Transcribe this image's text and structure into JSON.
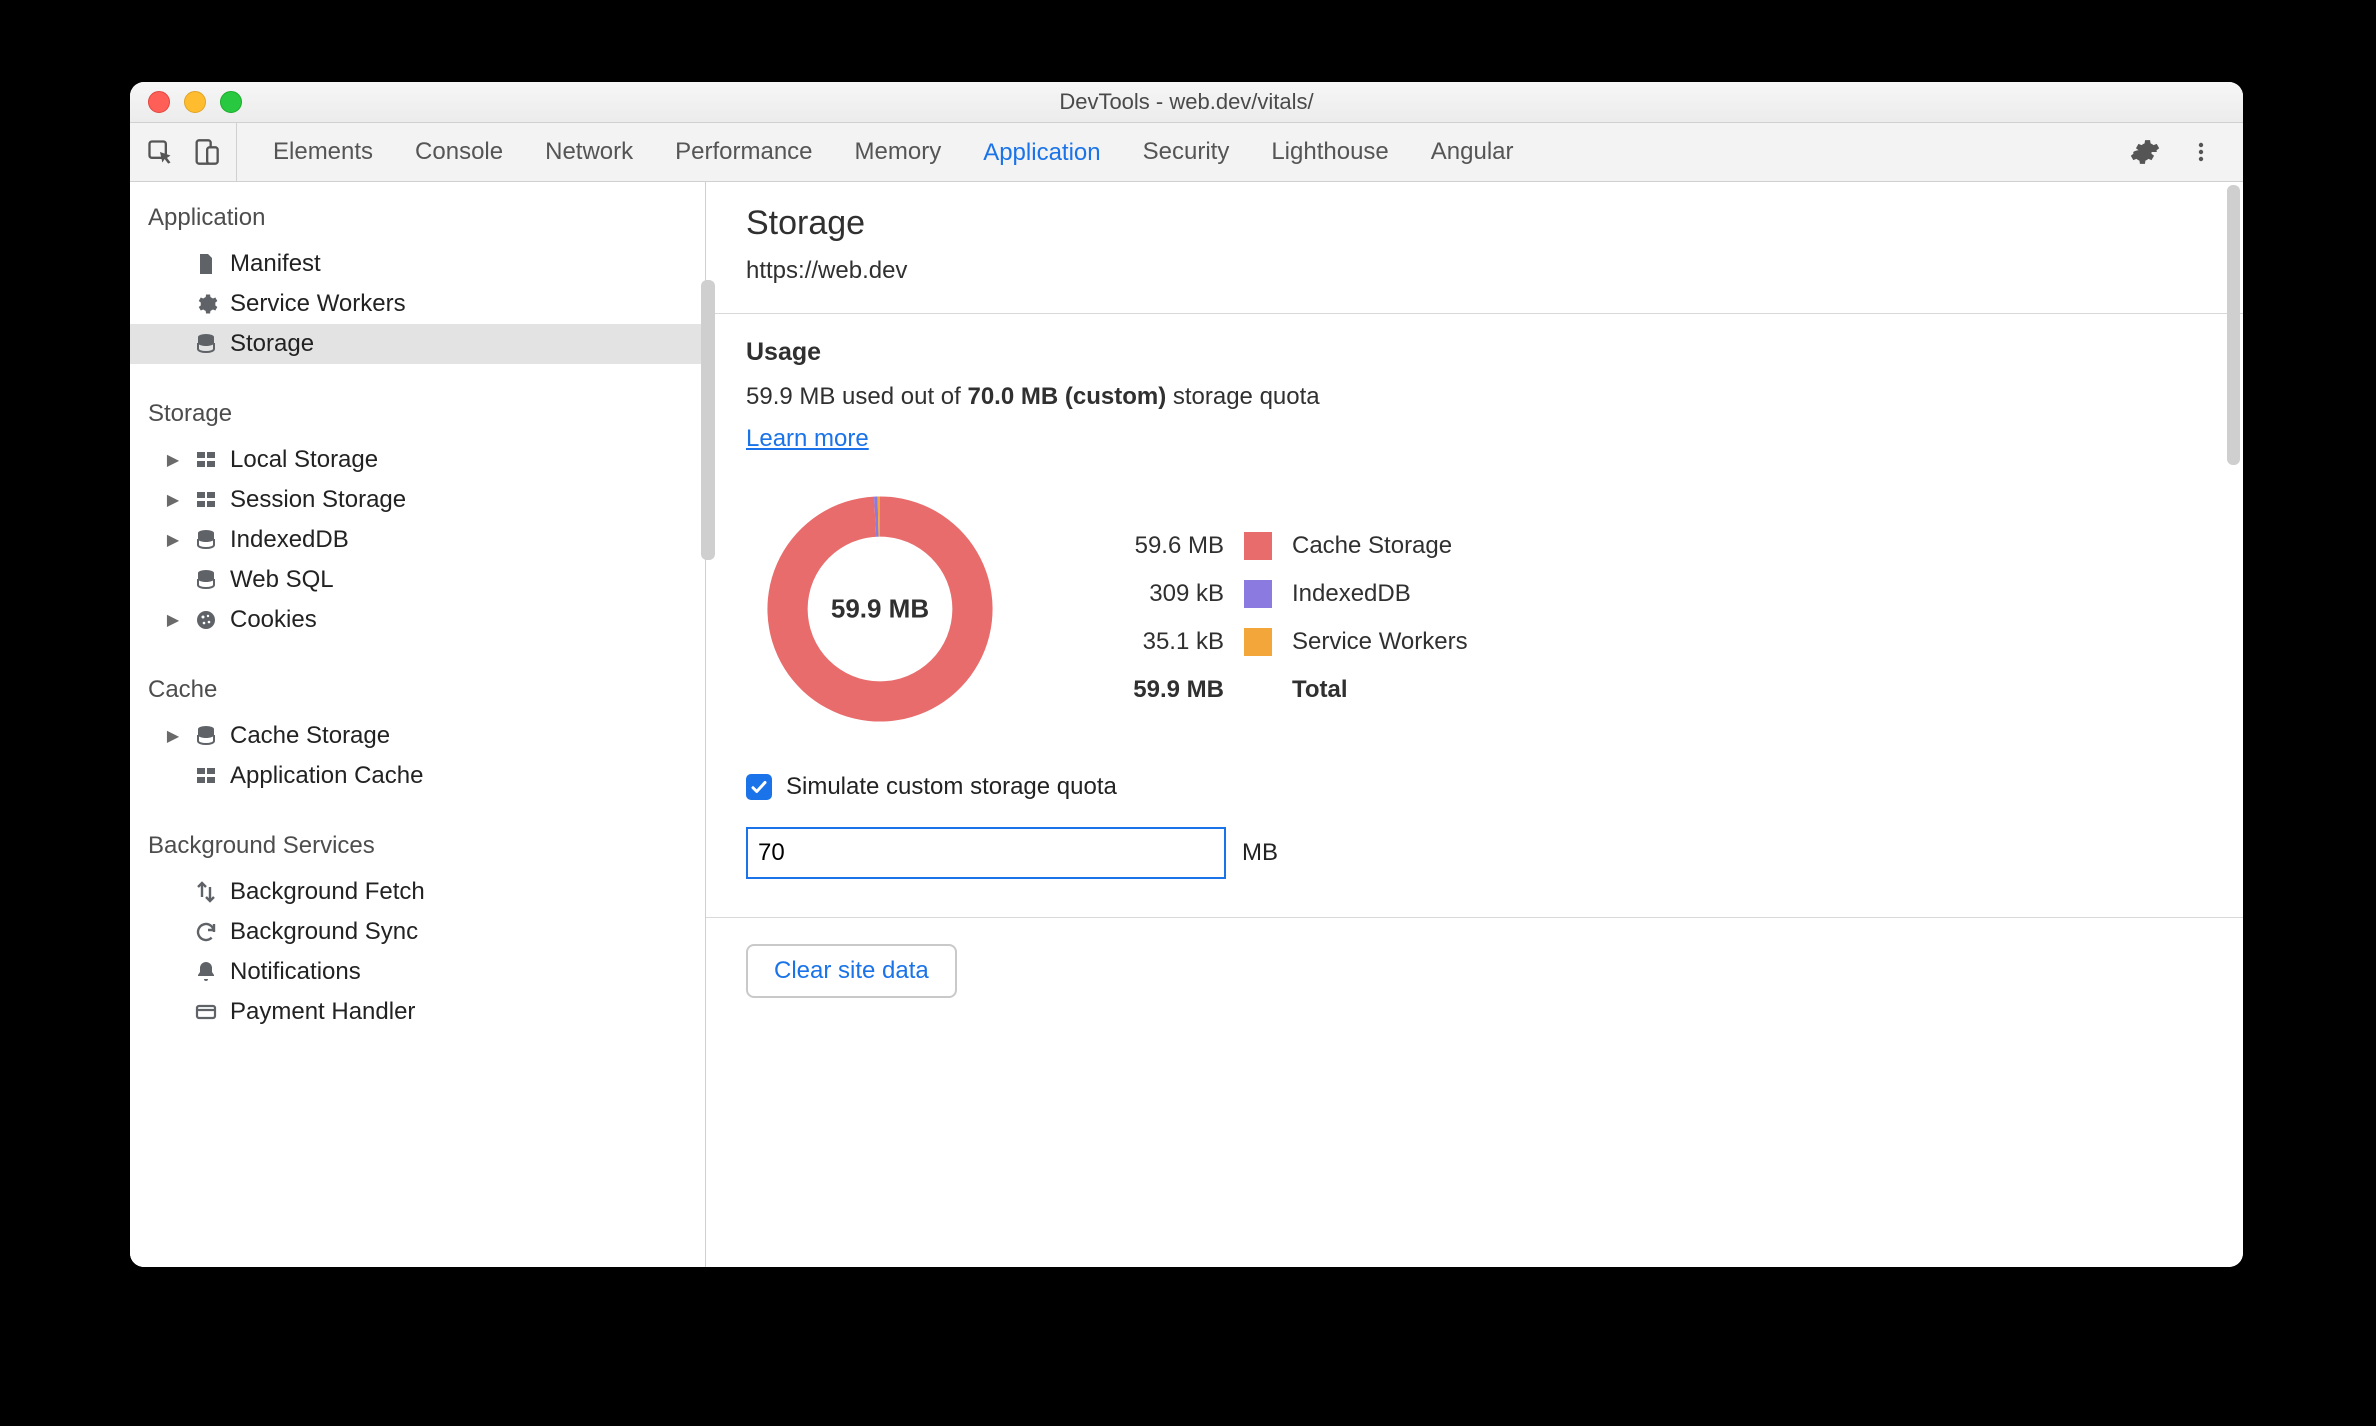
{
  "window": {
    "title": "DevTools - web.dev/vitals/"
  },
  "tabs": {
    "items": [
      {
        "label": "Elements",
        "active": false
      },
      {
        "label": "Console",
        "active": false
      },
      {
        "label": "Network",
        "active": false
      },
      {
        "label": "Performance",
        "active": false
      },
      {
        "label": "Memory",
        "active": false
      },
      {
        "label": "Application",
        "active": true
      },
      {
        "label": "Security",
        "active": false
      },
      {
        "label": "Lighthouse",
        "active": false
      },
      {
        "label": "Angular",
        "active": false
      }
    ]
  },
  "sidebar": {
    "sections": [
      {
        "title": "Application",
        "items": [
          {
            "icon": "file",
            "label": "Manifest",
            "expandable": false
          },
          {
            "icon": "gear",
            "label": "Service Workers",
            "expandable": false
          },
          {
            "icon": "db",
            "label": "Storage",
            "expandable": false,
            "selected": true
          }
        ]
      },
      {
        "title": "Storage",
        "items": [
          {
            "icon": "grid",
            "label": "Local Storage",
            "expandable": true
          },
          {
            "icon": "grid",
            "label": "Session Storage",
            "expandable": true
          },
          {
            "icon": "db",
            "label": "IndexedDB",
            "expandable": true
          },
          {
            "icon": "db",
            "label": "Web SQL",
            "expandable": false
          },
          {
            "icon": "cookie",
            "label": "Cookies",
            "expandable": true
          }
        ]
      },
      {
        "title": "Cache",
        "items": [
          {
            "icon": "db",
            "label": "Cache Storage",
            "expandable": true
          },
          {
            "icon": "grid",
            "label": "Application Cache",
            "expandable": false
          }
        ]
      },
      {
        "title": "Background Services",
        "items": [
          {
            "icon": "arrows",
            "label": "Background Fetch",
            "expandable": false
          },
          {
            "icon": "sync",
            "label": "Background Sync",
            "expandable": false
          },
          {
            "icon": "bell",
            "label": "Notifications",
            "expandable": false
          },
          {
            "icon": "card",
            "label": "Payment Handler",
            "expandable": false
          }
        ]
      }
    ]
  },
  "storage": {
    "heading": "Storage",
    "origin": "https://web.dev",
    "usage": {
      "heading": "Usage",
      "used": "59.9 MB",
      "quota": "70.0 MB (custom)",
      "line_prefix": " used out of ",
      "line_suffix": " storage quota",
      "learn_more": "Learn more",
      "center_label": "59.9 MB"
    },
    "breakdown": [
      {
        "size": "59.6 MB",
        "label": "Cache Storage",
        "color": "#e86c6c"
      },
      {
        "size": "309 kB",
        "label": "IndexedDB",
        "color": "#8b7ae0"
      },
      {
        "size": "35.1 kB",
        "label": "Service Workers",
        "color": "#f3a63a"
      }
    ],
    "total": {
      "size": "59.9 MB",
      "label": "Total"
    },
    "simulate": {
      "label": "Simulate custom storage quota",
      "checked": true,
      "value": "70",
      "unit": "MB"
    },
    "clear_label": "Clear site data"
  },
  "chart_data": {
    "type": "pie",
    "title": "Storage usage",
    "categories": [
      "Cache Storage",
      "IndexedDB",
      "Service Workers"
    ],
    "values": [
      59.6,
      0.309,
      0.0351
    ],
    "unit": "MB",
    "total": 59.9,
    "colors": [
      "#e86c6c",
      "#8b7ae0",
      "#f3a63a"
    ],
    "center_label": "59.9 MB"
  }
}
